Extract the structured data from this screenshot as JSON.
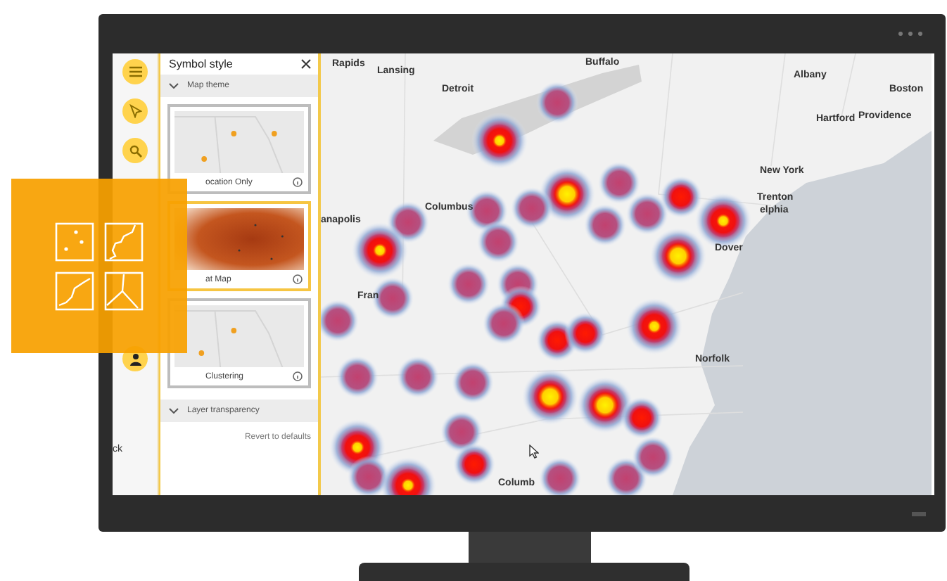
{
  "panel": {
    "title": "Symbol style",
    "sections": [
      {
        "label": "Map theme",
        "expanded": true
      },
      {
        "label": "Layer transparency",
        "expanded": true
      }
    ],
    "themes": [
      {
        "label": "ocation Only",
        "kind": "points",
        "selected": false
      },
      {
        "label": "at Map",
        "kind": "heat",
        "selected": true
      },
      {
        "label": "Clustering",
        "kind": "cluster",
        "selected": false
      }
    ],
    "revert": "Revert to defaults"
  },
  "toolbar": {
    "cut_label": "ck"
  },
  "map": {
    "labels": [
      "Rapids",
      "Lansing",
      "Detroit",
      "Buffalo",
      "Albany",
      "Boston",
      "Hartford",
      "Providence",
      "New York",
      "Trenton",
      "elphia",
      "Columbus",
      "anapolis",
      "Dover",
      "Norfolk",
      "Fran",
      "Columb"
    ]
  }
}
